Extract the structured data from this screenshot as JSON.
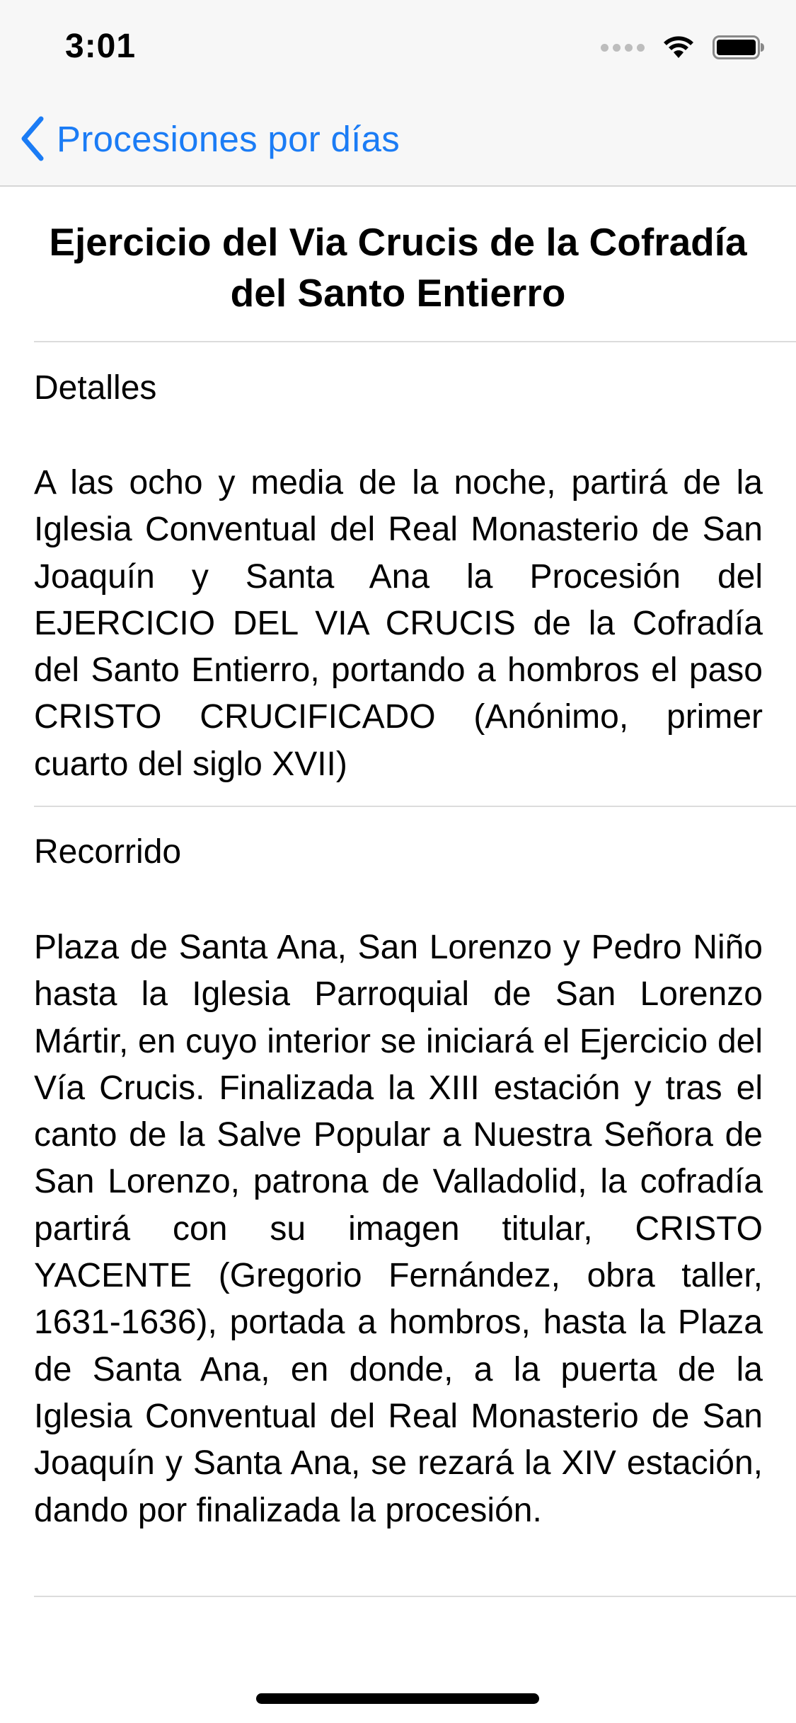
{
  "status_bar": {
    "time": "3:01",
    "icons": [
      "signal-dots-icon",
      "wifi-icon",
      "battery-icon"
    ]
  },
  "nav": {
    "back_label": "Procesiones por días",
    "accent_color": "#1b7cf5"
  },
  "detail": {
    "title": "Ejercicio del Via Crucis de la Cofradía del Santo Entierro",
    "sections": [
      {
        "heading": "Detalles",
        "text": "A las ocho y media de la noche, partirá de la Iglesia Conventual del Real Monasterio de San Joaquín y Santa Ana la Procesión del EJERCICIO DEL VIA CRUCIS de la Cofradía del Santo Entierro, portando a hombros el paso CRISTO CRUCIFICADO (Anónimo, primer cuarto del siglo XVII)"
      },
      {
        "heading": "Recorrido",
        "text": "Plaza de Santa Ana, San Lorenzo y Pedro Niño hasta la Iglesia Parroquial de San Lorenzo Mártir, en cuyo interior se iniciará el Ejercicio del Vía Crucis. Finalizada la XIII estación y tras el canto de la Salve Popular a Nuestra Señora de San Lorenzo, patrona de Valladolid, la cofradía partirá con su imagen titular, CRISTO YACENTE (Gregorio Fernández, obra taller, 1631-1636), portada a hombros, hasta la Plaza de Santa Ana, en donde, a la puerta de la Iglesia Conventual del Real Monasterio de San Joaquín y Santa Ana, se rezará la XIV estación, dando por finalizada la procesión."
      }
    ]
  }
}
